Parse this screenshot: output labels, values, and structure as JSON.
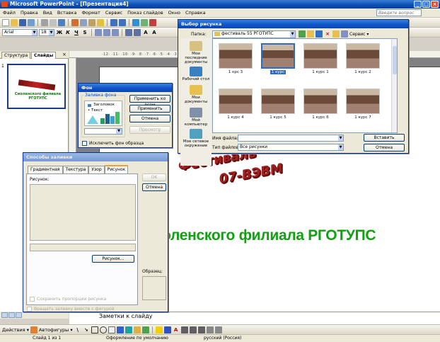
{
  "app": {
    "title": "Microsoft PowerPoint - [Презентация4]",
    "help_placeholder": "Введите вопрос"
  },
  "menu": [
    "Файл",
    "Правка",
    "Вид",
    "Вставка",
    "Формат",
    "Сервис",
    "Показ слайдов",
    "Окно",
    "Справка"
  ],
  "format_toolbar": {
    "font": "Arial",
    "size": "18"
  },
  "left_panel": {
    "tab_structure": "Структура",
    "tab_slides": "Слайды",
    "slide_number": "1",
    "thumb_text": "Смоленского филиала РГОТУПС"
  },
  "ruler": "·12· ·11· ·10· ·9· ·8· ·7· ·6· ·5· ·4· ·3· ·2· ·1· ·0· ·1· ·2· ·3·",
  "slide": {
    "wordart_line1": "Фестиваль",
    "wordart_line2": "07-ВЭВМ",
    "subtitle": "оленского филиала РГОТУПС"
  },
  "notes": "Заметки к слайду",
  "draw_toolbar": {
    "actions": "Действия ▾",
    "autoshapes": "Автофигуры ▾"
  },
  "status": {
    "slide": "Слайд 1 из 1",
    "design": "Оформление по умолчанию",
    "language": "русский (Россия)"
  },
  "bg_dialog": {
    "title": "Фон",
    "group_label": "Заливка фона",
    "legend_title": "Заголовок",
    "legend_text": "• Текст",
    "apply_all": "Применить ко всем",
    "apply": "Применить",
    "cancel": "Отмена",
    "preview": "Просмотр",
    "omit_master": "Исключить фон образца"
  },
  "fill_dialog": {
    "title": "Способы заливки",
    "tabs": [
      "Градиентная",
      "Текстура",
      "Узор",
      "Рисунок"
    ],
    "ok": "OK",
    "cancel": "Отмена",
    "picture_label": "Рисунок:",
    "picture_button": "Рисунок...",
    "sample_label": "Образец:",
    "lock_ratio": "Сохранить пропорции рисунка",
    "rotate_with_shape": "Вращать заливку вместе с фигурой"
  },
  "file_dialog": {
    "title": "Выбор рисунка",
    "folder_label": "Папка:",
    "folder": "фестиваль 55 РГОТУПС",
    "tools": "Сервис ▾",
    "places": [
      "Мои последние документы",
      "Рабочий стол",
      "Мои документы",
      "Мой компьютер",
      "Мое сетевое окружение"
    ],
    "files": [
      "1 крс 3",
      "1 курс",
      "1 курс 1",
      "1 курс 2",
      "1 курс 4",
      "1 курс 5",
      "1 курс 6",
      "1 курс 7"
    ],
    "filename_label": "Имя файла:",
    "filetype_label": "Тип файлов:",
    "filetype": "Все рисунки",
    "insert": "Вставить",
    "cancel": "Отмена"
  },
  "colors": {
    "title_blue": "#0a4fb5",
    "wordart_red": "#a02020",
    "subtitle_green": "#10a010"
  }
}
